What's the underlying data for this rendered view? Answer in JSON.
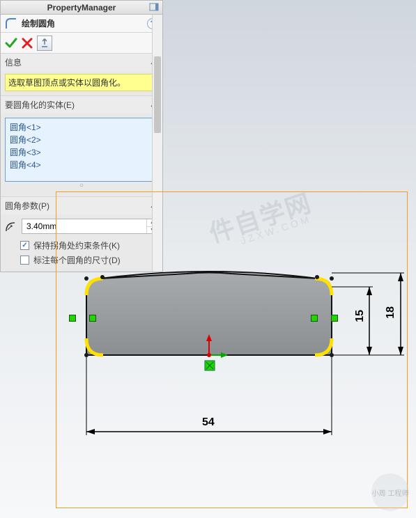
{
  "panel": {
    "title": "PropertyManager",
    "feature_title": "绘制圆角",
    "sections": {
      "info": {
        "title": "信息",
        "message": "选取草图顶点或实体以圆角化。"
      },
      "entities": {
        "title": "要圆角化的实体(E)",
        "items": [
          "圆角<1>",
          "圆角<2>",
          "圆角<3>",
          "圆角<4>"
        ]
      },
      "params": {
        "title": "圆角参数(P)",
        "radius": "3.40mm",
        "keep_constraints_label": "保持拐角处约束条件(K)",
        "keep_constraints_checked": true,
        "label_each_label": "标注每个圆角的尺寸(D)",
        "label_each_checked": false
      }
    }
  },
  "dimensions": {
    "width": "54",
    "height_outer": "18",
    "height_inner": "15"
  },
  "watermark": {
    "line1": "件自学网",
    "line2": "JZXW.COM",
    "corner": "小周\n工程师"
  }
}
